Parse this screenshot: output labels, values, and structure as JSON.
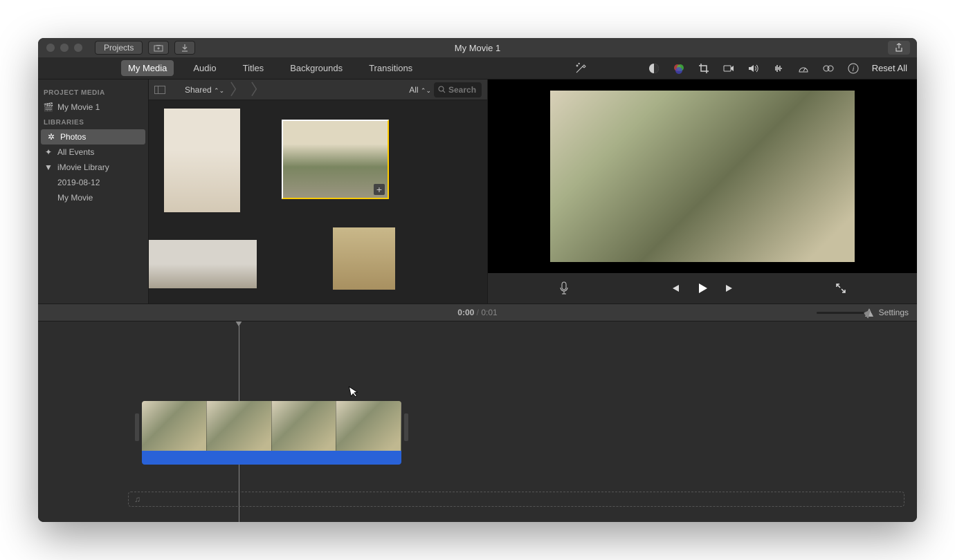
{
  "window_title": "My Movie 1",
  "toolbar": {
    "projects": "Projects"
  },
  "tabs": [
    "My Media",
    "Audio",
    "Titles",
    "Backgrounds",
    "Transitions"
  ],
  "active_tab": 0,
  "reset_label": "Reset All",
  "sidebar": {
    "sections": [
      {
        "header": "PROJECT MEDIA",
        "items": [
          {
            "icon": "clapper",
            "label": "My Movie 1"
          }
        ]
      },
      {
        "header": "LIBRARIES",
        "items": [
          {
            "icon": "photos",
            "label": "Photos",
            "selected": true
          },
          {
            "icon": "star",
            "label": "All Events"
          },
          {
            "icon": "tri",
            "label": "iMovie Library",
            "expand": true
          },
          {
            "icon": "",
            "label": "2019-08-12",
            "indent": true
          },
          {
            "icon": "",
            "label": "My Movie",
            "indent": true
          }
        ]
      }
    ]
  },
  "browser": {
    "breadcrumb": "Shared",
    "filter": "All",
    "search_placeholder": "Search"
  },
  "timeline": {
    "current": "0:00",
    "total": "0:01",
    "settings_label": "Settings"
  },
  "audio_track_hint": "♫"
}
